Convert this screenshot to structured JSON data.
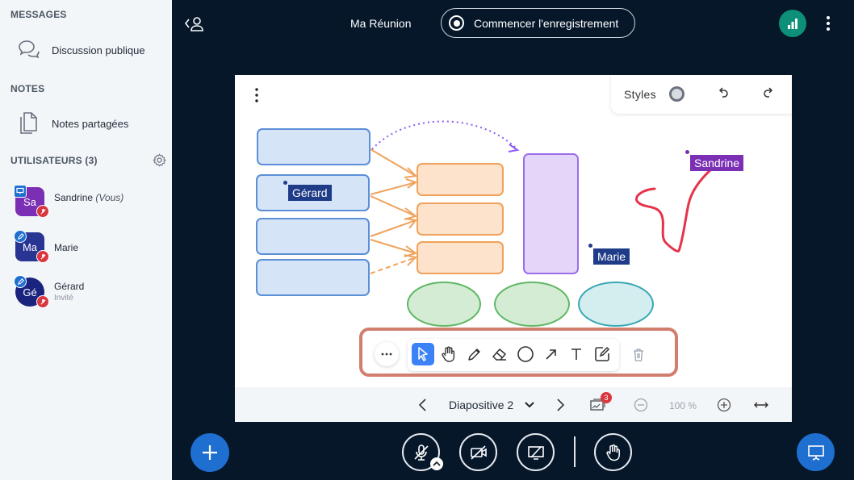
{
  "sidebar": {
    "messages_title": "MESSAGES",
    "public_chat_label": "Discussion publique",
    "notes_title": "NOTES",
    "shared_notes_label": "Notes partagées",
    "users_title": "UTILISATEURS (3)",
    "users": [
      {
        "initials": "Sa",
        "name": "Sandrine",
        "suffix": "(Vous)",
        "role": "",
        "color": "#7b2fb5"
      },
      {
        "initials": "Ma",
        "name": "Marie",
        "suffix": "",
        "role": "",
        "color": "#283593"
      },
      {
        "initials": "Gé",
        "name": "Gérard",
        "suffix": "",
        "role": "Invité",
        "color": "#1a237e"
      }
    ]
  },
  "header": {
    "meeting_title": "Ma Réunion",
    "record_label": "Commencer l'enregistrement"
  },
  "whiteboard": {
    "styles_label": "Styles",
    "cursors": [
      {
        "name": "Gérard",
        "color": "#1f3c88"
      },
      {
        "name": "Sandrine",
        "color": "#7b2fb5"
      },
      {
        "name": "Marie",
        "color": "#1f3c88"
      }
    ],
    "tools": [
      "more-icon",
      "select-icon",
      "hand-icon",
      "pencil-icon",
      "eraser-icon",
      "ellipse-icon",
      "arrow-icon",
      "text-icon",
      "note-icon",
      "trash-icon"
    ],
    "slide_name": "Diapositive 2",
    "multi_user_count": "3",
    "zoom": "100 %"
  },
  "colors": {
    "accent": "#1f6fd1",
    "highlight_frame": "#d27e6f",
    "background": "#06172a"
  }
}
